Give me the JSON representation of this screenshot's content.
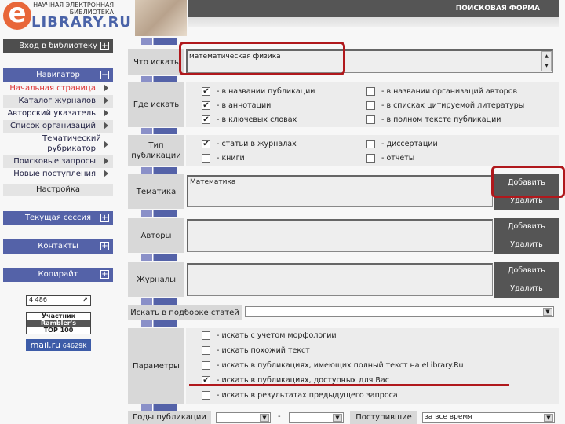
{
  "logo": {
    "top": "НАУЧНАЯ ЭЛЕКТРОННАЯ БИБЛИОТЕКА",
    "main": "LIBRARY.RU",
    "e": "e"
  },
  "header": {
    "title": "ПОИСКОВАЯ ФОРМА"
  },
  "sidebar": {
    "login": "Вход в библиотеку",
    "navigator": "Навигатор",
    "items": [
      {
        "label": "Начальная страница",
        "active": true
      },
      {
        "label": "Каталог журналов"
      },
      {
        "label": "Авторский указатель"
      },
      {
        "label": "Список организаций"
      },
      {
        "label": "Тематический рубрикатор"
      },
      {
        "label": "Поисковые запросы"
      },
      {
        "label": "Новые поступления"
      }
    ],
    "settings": "Настройка",
    "session": "Текущая сессия",
    "contacts": "Контакты",
    "copyright": "Копирайт",
    "counters": {
      "c1": "4 486",
      "rambler1": "Участник",
      "rambler2": "Rambler's",
      "rambler3": "TOP 100",
      "mail": "mail.ru",
      "mail_count": "64629K"
    }
  },
  "form": {
    "what": {
      "label": "Что искать",
      "value": "математическая физика"
    },
    "where": {
      "label": "Где искать",
      "options": [
        {
          "label": "- в названии публикации",
          "checked": true
        },
        {
          "label": "- в аннотации",
          "checked": true
        },
        {
          "label": "- в ключевых словах",
          "checked": true
        },
        {
          "label": "- в названии организаций авторов",
          "checked": false
        },
        {
          "label": "- в списках цитируемой литературы",
          "checked": false
        },
        {
          "label": "- в полном тексте публикации",
          "checked": false
        }
      ]
    },
    "type": {
      "label": "Тип публикации",
      "options": [
        {
          "label": "- статьи в журналах",
          "checked": true
        },
        {
          "label": "- книги",
          "checked": false
        },
        {
          "label": "- диссертации",
          "checked": false
        },
        {
          "label": "- отчеты",
          "checked": false
        }
      ]
    },
    "topic": {
      "label": "Тематика",
      "value": "Математика"
    },
    "authors": {
      "label": "Авторы",
      "value": ""
    },
    "journals": {
      "label": "Журналы",
      "value": ""
    },
    "add": "Добавить",
    "remove": "Удалить",
    "collection": {
      "label": "Искать в подборке статей",
      "value": ""
    },
    "params": {
      "label": "Параметры",
      "options": [
        {
          "label": "- искать с учетом морфологии",
          "checked": false
        },
        {
          "label": "- искать похожий текст",
          "checked": false
        },
        {
          "label": "- искать в публикациях, имеющих полный текст на eLibrary.Ru",
          "checked": false
        },
        {
          "label": "- искать в публикациях, доступных для Вас",
          "checked": true
        },
        {
          "label": "- искать в результатах предыдущего запроса",
          "checked": false
        }
      ]
    },
    "year": {
      "label": "Годы публикации",
      "from": "",
      "dash": "-",
      "to": ""
    },
    "received": {
      "label": "Поступившие",
      "value": "за все время"
    }
  },
  "colors": {
    "annotation": "#b0181c",
    "nav_blue": "#5462a8",
    "dark": "#4e4e4e"
  }
}
